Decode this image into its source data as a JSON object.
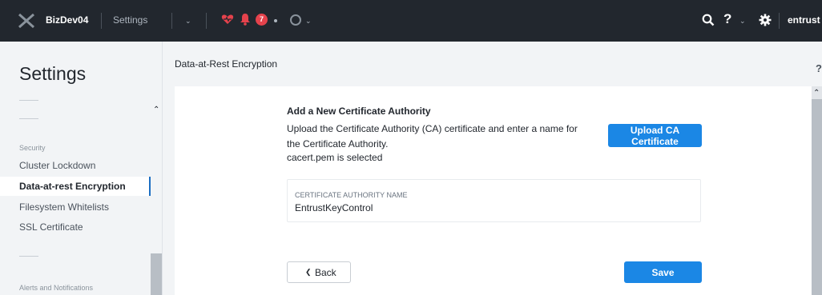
{
  "topbar": {
    "cluster_name": "BizDev04",
    "page_name": "Settings",
    "alert_count": "7",
    "help_label": "?",
    "user_name": "entrust"
  },
  "sidebar": {
    "title": "Settings",
    "groups": [
      {
        "header": "Security",
        "items": [
          "Cluster Lockdown",
          "Data-at-rest Encryption",
          "Filesystem Whitelists",
          "SSL Certificate"
        ],
        "active": "Data-at-rest Encryption"
      },
      {
        "header": "Alerts and Notifications"
      }
    ]
  },
  "content": {
    "title": "Data-at-Rest Encryption",
    "help_label": "?",
    "section_title": "Add a New Certificate Authority",
    "section_desc": "Upload the Certificate Authority (CA) certificate and enter a name for the Certificate Authority.",
    "status": "cacert.pem is selected",
    "upload_button": "Upload CA Certificate",
    "field_label": "CERTIFICATE AUTHORITY NAME",
    "field_value": "EntrustKeyControl",
    "back_button": "Back",
    "save_button": "Save"
  },
  "colors": {
    "topbar_bg": "#22272e",
    "accent": "#1b87e5",
    "alert": "#e5424c",
    "health": "#e5424c",
    "active_border": "#1b6ec2"
  },
  "icons": [
    "logo-icon",
    "chevron-down-icon",
    "heart-icon",
    "bell-icon",
    "circle-icon",
    "search-icon",
    "help-icon",
    "gear-icon",
    "chevron-up-icon",
    "chevron-left-icon"
  ]
}
